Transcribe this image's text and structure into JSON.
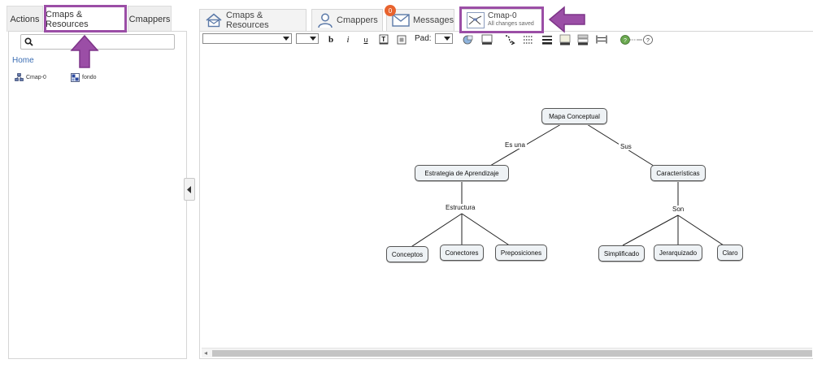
{
  "left_panel": {
    "tabs": [
      {
        "label": "Actions"
      },
      {
        "label": "Cmaps & Resources"
      },
      {
        "label": "Cmappers"
      }
    ],
    "search": {
      "placeholder": ""
    },
    "home_label": "Home",
    "resources": [
      {
        "label": "Cmap-0",
        "icon": "cmap-icon"
      },
      {
        "label": "fondo",
        "icon": "image-resource-icon"
      }
    ]
  },
  "top_tabs": {
    "cmaps_resources": "Cmaps & Resources",
    "cmappers": "Cmappers",
    "messages": "Messages",
    "messages_badge": "0",
    "document_title": "Cmap-0",
    "document_status": "All changes saved"
  },
  "toolbar": {
    "pad_label": "Pad:",
    "bold": "b",
    "italic": "i",
    "underline": "u"
  },
  "concept_map": {
    "concepts": {
      "root": "Mapa Conceptual",
      "strategy": "Estrategia de Aprendizaje",
      "characteristics": "Características",
      "concepts": "Conceptos",
      "connectors": "Conectores",
      "propositions": "Preposiciones",
      "simplified": "Simplificado",
      "hierarchical": "Jerarquizado",
      "clear": "Claro"
    },
    "linking_phrases": {
      "es_una": "Es una",
      "sus": "Sus",
      "estructura": "Estructura",
      "son": "Son"
    }
  },
  "colors": {
    "highlight": "#9b4ea6",
    "badge": "#e8632e",
    "link_blue": "#3b6db3"
  }
}
